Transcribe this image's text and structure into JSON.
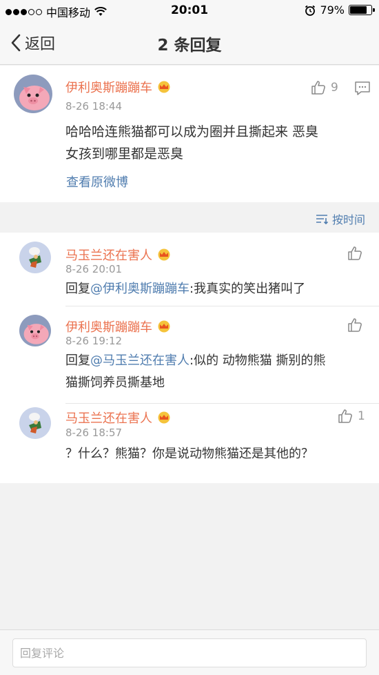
{
  "status_bar": {
    "carrier": "中国移动",
    "time": "20:01",
    "battery_percent": "79%",
    "battery_level": 0.79
  },
  "nav": {
    "back_label": "返回",
    "title": "2 条回复"
  },
  "main_post": {
    "user_name": "伊利奥斯蹦蹦车",
    "time": "8-26 18:44",
    "text_line1": "哈哈哈连熊猫都可以成为圈并且撕起来 恶臭",
    "text_line2": "女孩到哪里都是恶臭",
    "like_count": "9",
    "view_origin_label": "查看原微博"
  },
  "sort_label": "按时间",
  "replies": [
    {
      "user_name": "马玉兰还在害人",
      "time": "8-26 20:01",
      "prefix": "回复",
      "mention": "@伊利奥斯蹦蹦车",
      "text_line1": ":我真实的笑出猪叫了",
      "like_count": ""
    },
    {
      "user_name": "伊利奥斯蹦蹦车",
      "time": "8-26 19:12",
      "prefix": "回复",
      "mention": "@马玉兰还在害人",
      "text_line1": ":似的 动物熊猫 撕别的熊",
      "text_line2": "猫撕饲养员撕基地",
      "like_count": ""
    },
    {
      "user_name": "马玉兰还在害人",
      "time": "8-26 18:57",
      "text_line1": "？什么？熊猫？你是说动物熊猫还是其他的？",
      "like_count": "1"
    }
  ],
  "bottom": {
    "placeholder": "回复评论"
  },
  "colors": {
    "username": "#eb7350",
    "link": "#507daf",
    "meta": "#999999"
  }
}
